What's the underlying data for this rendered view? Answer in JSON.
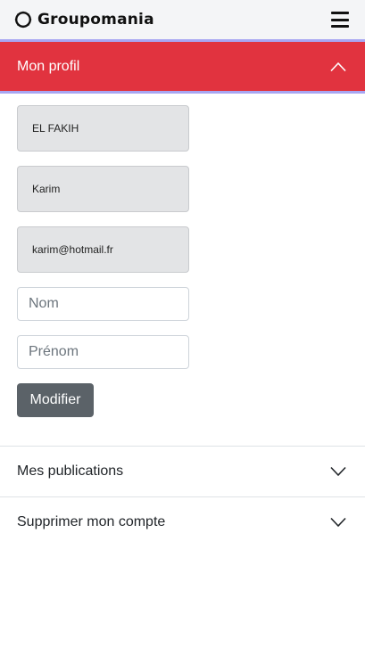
{
  "navbar": {
    "brand": "Groupomania",
    "logo_icon": "groupomania-globe-icon",
    "menu_icon": "hamburger-icon"
  },
  "profile": {
    "title": "Mon profil",
    "toggle_icon": "chevron-up-icon",
    "last_name_value": "EL FAKIH",
    "first_name_value": "Karim",
    "email_value": "karim@hotmail.fr",
    "nom_placeholder": "Nom",
    "prenom_placeholder": "Prénom",
    "submit_label": "Modifier"
  },
  "sections": [
    {
      "title": "Mes publications",
      "toggle_icon": "chevron-down-icon"
    },
    {
      "title": "Supprimer mon compte",
      "toggle_icon": "chevron-down-icon"
    }
  ],
  "colors": {
    "header_active": "#e1333f",
    "accent_line": "#a8a6f2",
    "button": "#5b6268",
    "navbar_bg": "#f4f5f7"
  }
}
